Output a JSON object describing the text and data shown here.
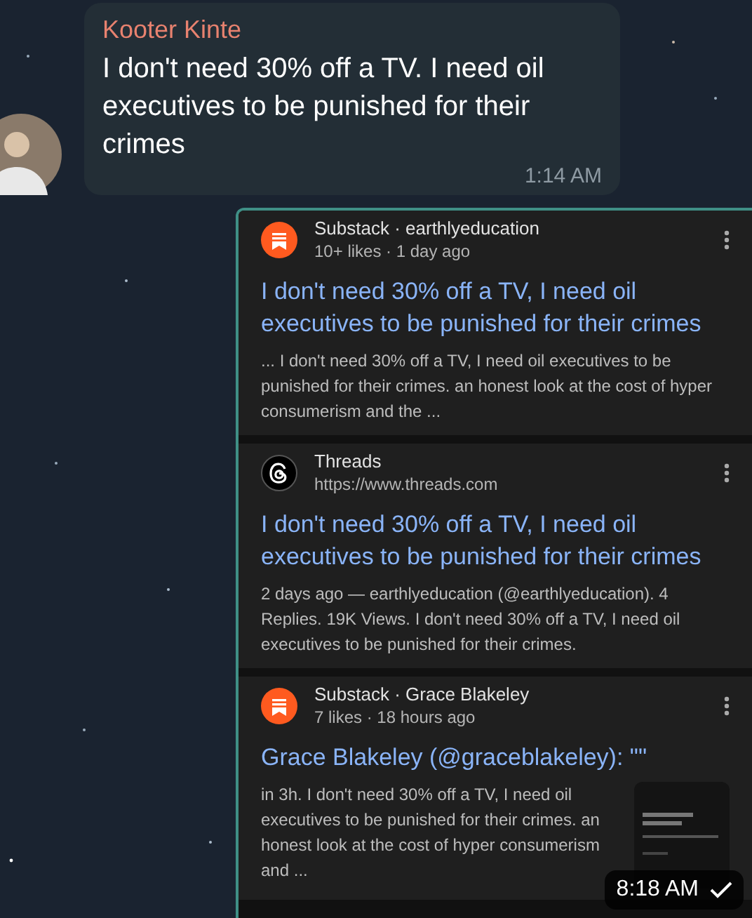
{
  "message": {
    "sender": "Kooter Kinte",
    "text": "I don't need 30% off a TV. I need oil executives to be punished for their crimes",
    "time": "1:14 AM"
  },
  "shared_image": {
    "time": "8:18 AM",
    "sent": true,
    "cards": [
      {
        "kind": "substack",
        "source": "Substack · earthlyeducation",
        "meta": "10+ likes · 1 day ago",
        "title": "I don't need 30% off a TV, I need oil executives to be punished for their crimes",
        "snippet": "... I don't need 30% off a TV, I need oil executives to be punished for their crimes. an honest look at the cost of hyper consumerism and the ..."
      },
      {
        "kind": "threads",
        "source": "Threads",
        "meta": "https://www.threads.com",
        "title": "I don't need 30% off a TV, I need oil executives to be punished for their crimes",
        "snippet": "2 days ago — earthlyeducation (@earthlyeducation). 4 Replies. 19K Views. I don't need 30% off a TV, I need oil executives to be punished for their crimes."
      },
      {
        "kind": "substack",
        "source": "Substack · Grace Blakeley",
        "meta": "7 likes · 18 hours ago",
        "title": "Grace Blakeley (@graceblakeley): \"\"",
        "snippet": "in 3h. I don't need 30% off a TV, I need oil executives to be punished for their crimes. an honest look at the cost of hyper consumerism and ..."
      }
    ]
  }
}
